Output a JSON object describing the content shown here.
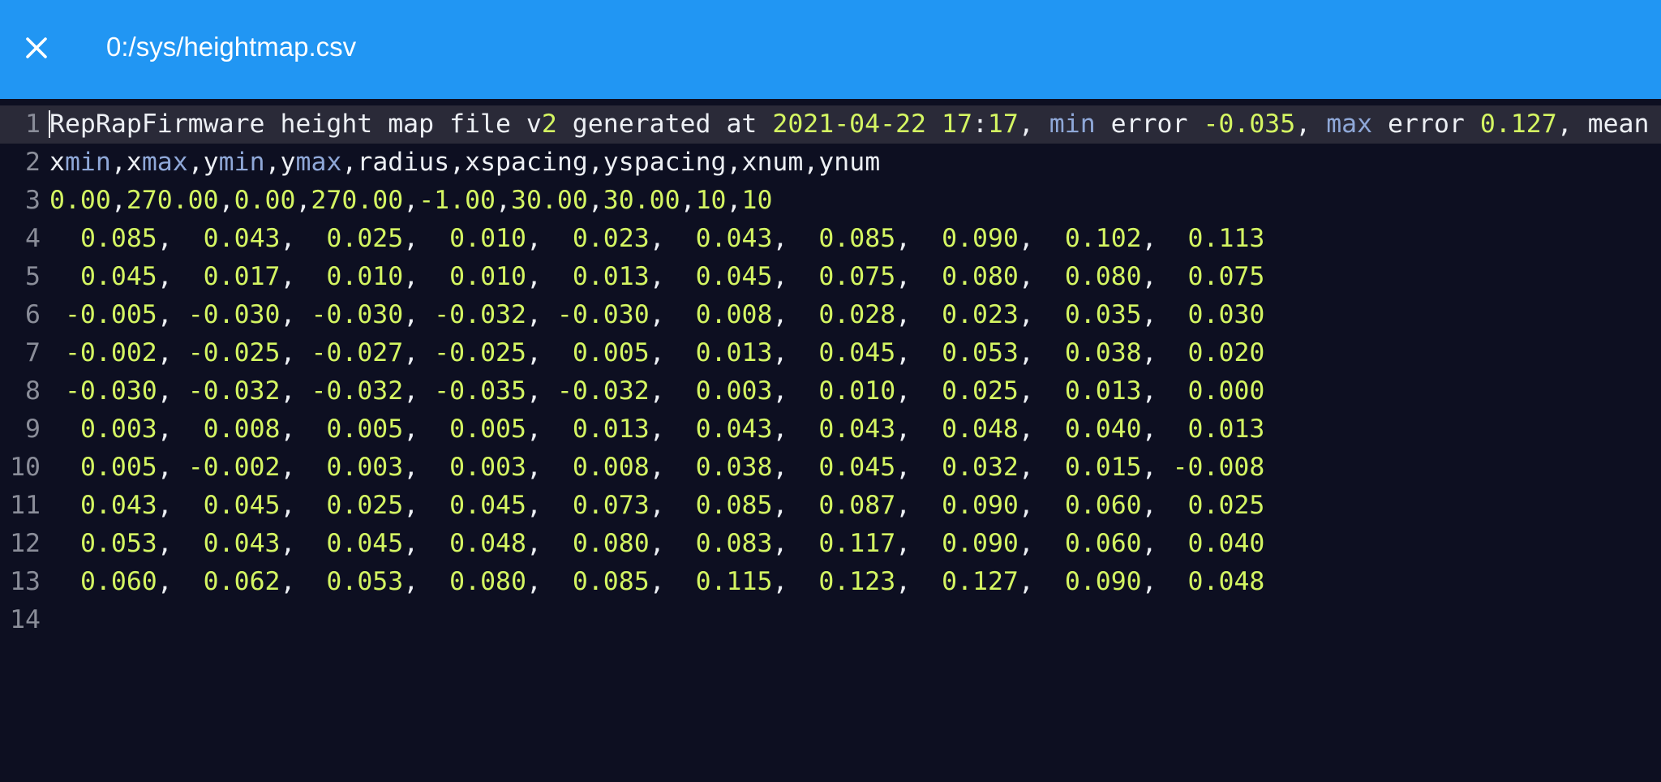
{
  "header": {
    "title": "0:/sys/heightmap.csv",
    "close_icon": "close-icon",
    "background_color": "#2196f3"
  },
  "editor": {
    "colors": {
      "background": "#0d0f21",
      "active_line": "#2a2a38",
      "number": "#d4f562",
      "keyword": "#8fa8d8",
      "text": "#eceff4",
      "gutter": "#8a8d99"
    },
    "lines": [
      {
        "num": "1",
        "text": "RepRapFirmware height map file v2 generated at 2021-04-22 17:17, min error -0.035, max error 0.127, mean"
      },
      {
        "num": "2",
        "text": "xmin,xmax,ymin,ymax,radius,xspacing,yspacing,xnum,ynum"
      },
      {
        "num": "3",
        "text": "0.00,270.00,0.00,270.00,-1.00,30.00,30.00,10,10"
      },
      {
        "num": "4",
        "text": "  0.085,  0.043,  0.025,  0.010,  0.023,  0.043,  0.085,  0.090,  0.102,  0.113"
      },
      {
        "num": "5",
        "text": "  0.045,  0.017,  0.010,  0.010,  0.013,  0.045,  0.075,  0.080,  0.080,  0.075"
      },
      {
        "num": "6",
        "text": " -0.005, -0.030, -0.030, -0.032, -0.030,  0.008,  0.028,  0.023,  0.035,  0.030"
      },
      {
        "num": "7",
        "text": " -0.002, -0.025, -0.027, -0.025,  0.005,  0.013,  0.045,  0.053,  0.038,  0.020"
      },
      {
        "num": "8",
        "text": " -0.030, -0.032, -0.032, -0.035, -0.032,  0.003,  0.010,  0.025,  0.013,  0.000"
      },
      {
        "num": "9",
        "text": "  0.003,  0.008,  0.005,  0.005,  0.013,  0.043,  0.043,  0.048,  0.040,  0.013"
      },
      {
        "num": "10",
        "text": "  0.005, -0.002,  0.003,  0.003,  0.008,  0.038,  0.045,  0.032,  0.015, -0.008"
      },
      {
        "num": "11",
        "text": "  0.043,  0.045,  0.025,  0.045,  0.073,  0.085,  0.087,  0.090,  0.060,  0.025"
      },
      {
        "num": "12",
        "text": "  0.053,  0.043,  0.045,  0.048,  0.080,  0.083,  0.117,  0.090,  0.060,  0.040"
      },
      {
        "num": "13",
        "text": "  0.060,  0.062,  0.053,  0.080,  0.085,  0.115,  0.123,  0.127,  0.090,  0.048"
      },
      {
        "num": "14",
        "text": ""
      }
    ]
  }
}
